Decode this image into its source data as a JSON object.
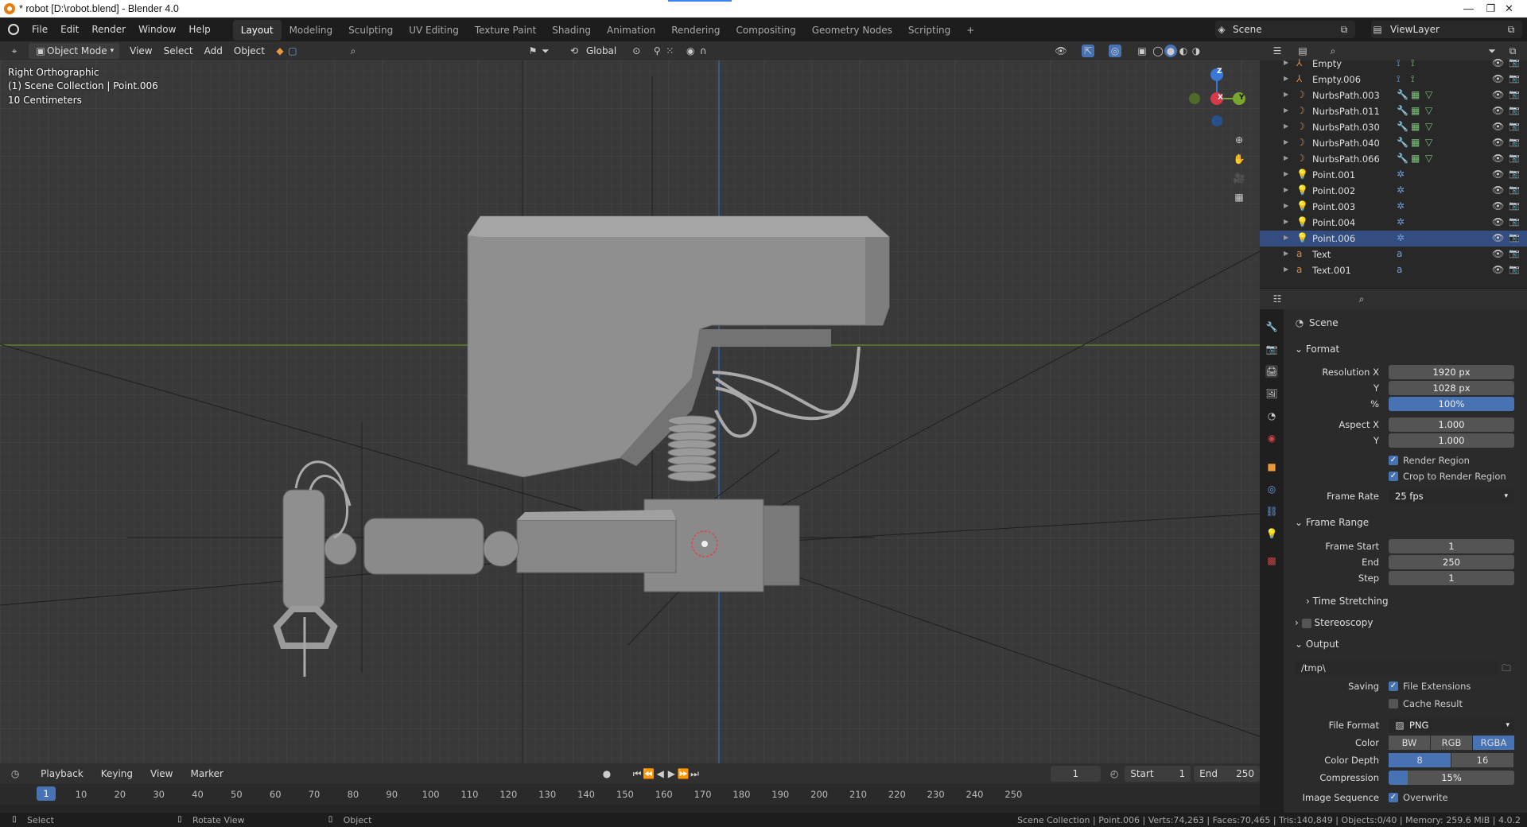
{
  "window": {
    "title": "* robot [D:\\robot.blend] - Blender 4.0",
    "min": "—",
    "max": "❐",
    "close": "✕"
  },
  "menu": [
    "File",
    "Edit",
    "Render",
    "Window",
    "Help"
  ],
  "workspaces": [
    "Layout",
    "Modeling",
    "Sculpting",
    "UV Editing",
    "Texture Paint",
    "Shading",
    "Animation",
    "Rendering",
    "Compositing",
    "Geometry Nodes",
    "Scripting"
  ],
  "workspace_add": "+",
  "scene": "Scene",
  "view_layer": "ViewLayer",
  "viewport_header": {
    "mode": "Object Mode",
    "menus": [
      "View",
      "Select",
      "Add",
      "Object"
    ],
    "orientation": "Global"
  },
  "overlay": {
    "view": "Right Orthographic",
    "collection": "(1) Scene Collection | Point.006",
    "scale": "10 Centimeters"
  },
  "gizmo": {
    "x": "X",
    "y": "Y",
    "z": "Z"
  },
  "outliner": [
    {
      "name": "Empty",
      "icon": "empty-icon",
      "color": "#e0863b"
    },
    {
      "name": "Empty.006",
      "icon": "empty-icon",
      "color": "#e0863b"
    },
    {
      "name": "NurbsPath.003",
      "icon": "curve-icon",
      "color": "#e0863b"
    },
    {
      "name": "NurbsPath.011",
      "icon": "curve-icon",
      "color": "#e0863b"
    },
    {
      "name": "NurbsPath.030",
      "icon": "curve-icon",
      "color": "#e0863b"
    },
    {
      "name": "NurbsPath.040",
      "icon": "curve-icon",
      "color": "#e0863b"
    },
    {
      "name": "NurbsPath.066",
      "icon": "curve-icon",
      "color": "#e0863b"
    },
    {
      "name": "Point.001",
      "icon": "light-icon",
      "color": "#e0863b"
    },
    {
      "name": "Point.002",
      "icon": "light-icon",
      "color": "#e0863b"
    },
    {
      "name": "Point.003",
      "icon": "light-icon",
      "color": "#e0863b"
    },
    {
      "name": "Point.004",
      "icon": "light-icon",
      "color": "#e0863b"
    },
    {
      "name": "Point.006",
      "icon": "light-icon",
      "color": "#e0863b"
    },
    {
      "name": "Text",
      "icon": "text-icon",
      "color": "#e0863b"
    },
    {
      "name": "Text.001",
      "icon": "text-icon",
      "color": "#e0863b"
    }
  ],
  "properties": {
    "context": "Scene",
    "format": {
      "title": "Format",
      "resolution_x_label": "Resolution X",
      "resolution_x": "1920 px",
      "resolution_y_label": "Y",
      "resolution_y": "1028 px",
      "percent_label": "%",
      "percent": "100%",
      "aspect_x_label": "Aspect X",
      "aspect_x": "1.000",
      "aspect_y_label": "Y",
      "aspect_y": "1.000",
      "render_region": "Render Region",
      "crop": "Crop to Render Region",
      "frame_rate_label": "Frame Rate",
      "frame_rate": "25 fps"
    },
    "frame_range": {
      "title": "Frame Range",
      "start_label": "Frame Start",
      "start": "1",
      "end_label": "End",
      "end": "250",
      "step_label": "Step",
      "step": "1"
    },
    "time_stretching": "Time Stretching",
    "stereoscopy": "Stereoscopy",
    "output": {
      "title": "Output",
      "path": "/tmp\\",
      "saving_label": "Saving",
      "file_extensions": "File Extensions",
      "cache_result": "Cache Result",
      "file_format_label": "File Format",
      "file_format": "PNG",
      "color_label": "Color",
      "color_options": [
        "BW",
        "RGB",
        "RGBA"
      ],
      "color_selected": "RGBA",
      "depth_label": "Color Depth",
      "depth_options": [
        "8",
        "16"
      ],
      "depth_selected": "8",
      "compression_label": "Compression",
      "compression": "15%",
      "compression_value": 0.15,
      "image_sequence_label": "Image Sequence",
      "overwrite": "Overwrite"
    }
  },
  "timeline": {
    "menus": [
      "Playback",
      "Keying",
      "View",
      "Marker"
    ],
    "current_frame": "1",
    "start_label": "Start",
    "start": "1",
    "end_label": "End",
    "end": "250",
    "ticks": [
      "1",
      "10",
      "20",
      "30",
      "40",
      "50",
      "60",
      "70",
      "80",
      "90",
      "100",
      "110",
      "120",
      "130",
      "140",
      "150",
      "160",
      "170",
      "180",
      "190",
      "200",
      "210",
      "220",
      "230",
      "240",
      "250"
    ]
  },
  "status": {
    "select": "Select",
    "rotate": "Rotate View",
    "object": "Object",
    "stats": "Scene Collection | Point.006 | Verts:74,263 | Faces:70,465 | Tris:140,849 | Objects:0/40 | Memory: 259.6 MiB | 4.0.2"
  }
}
